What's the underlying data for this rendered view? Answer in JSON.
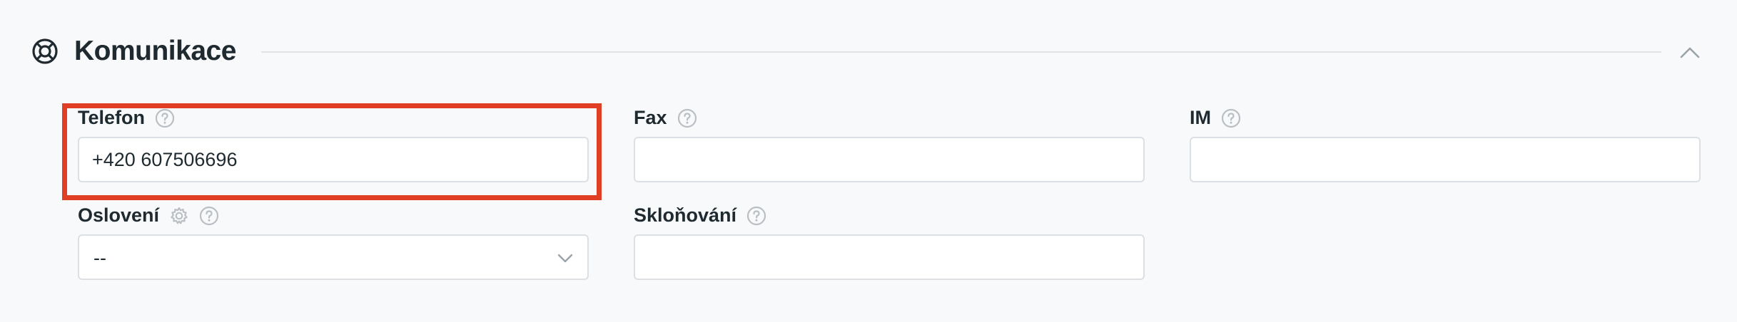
{
  "section": {
    "title": "Komunikace",
    "icon": "lifebuoy-icon",
    "collapse_icon": "chevron-up-icon"
  },
  "fields": {
    "telefon": {
      "label": "Telefon",
      "value": "+420 607506696"
    },
    "fax": {
      "label": "Fax",
      "value": ""
    },
    "im": {
      "label": "IM",
      "value": ""
    },
    "osloveni": {
      "label": "Oslovení",
      "selected": "--"
    },
    "sklonovani": {
      "label": "Skloňování",
      "value": ""
    }
  },
  "colors": {
    "highlight": "#e03e25",
    "background": "#f8f9fa",
    "icon_gray": "#b9bfc4"
  }
}
